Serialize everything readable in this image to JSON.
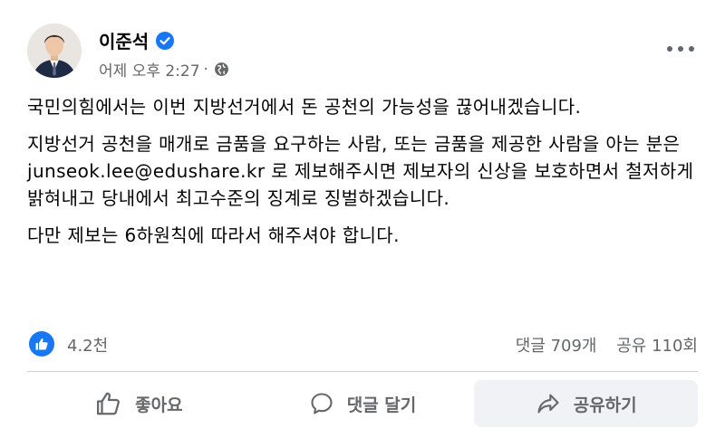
{
  "author": {
    "name": "이준석"
  },
  "meta": {
    "time": "어제 오후 2:27",
    "separator": "·"
  },
  "body": {
    "paragraphs": [
      "국민의힘에서는 이번 지방선거에서 돈 공천의 가능성을 끊어내겠습니다.",
      "지방선거 공천을 매개로 금품을 요구하는 사람, 또는 금품을 제공한 사람을 아는 분은 junseok.lee@edushare.kr 로 제보해주시면 제보자의 신상을 보호하면서 철저하게 밝혀내고 당내에서 최고수준의 징계로 징벌하겠습니다.",
      "다만 제보는 6하원칙에 따라서 해주셔야 합니다."
    ]
  },
  "stats": {
    "likes": "4.2천",
    "comments": "댓글 709개",
    "shares": "공유 110회"
  },
  "actions": {
    "like": "좋아요",
    "comment": "댓글 달기",
    "share": "공유하기"
  },
  "colors": {
    "brand": "#1877f2",
    "secondary_text": "#65676b",
    "divider": "#ced0d4"
  }
}
